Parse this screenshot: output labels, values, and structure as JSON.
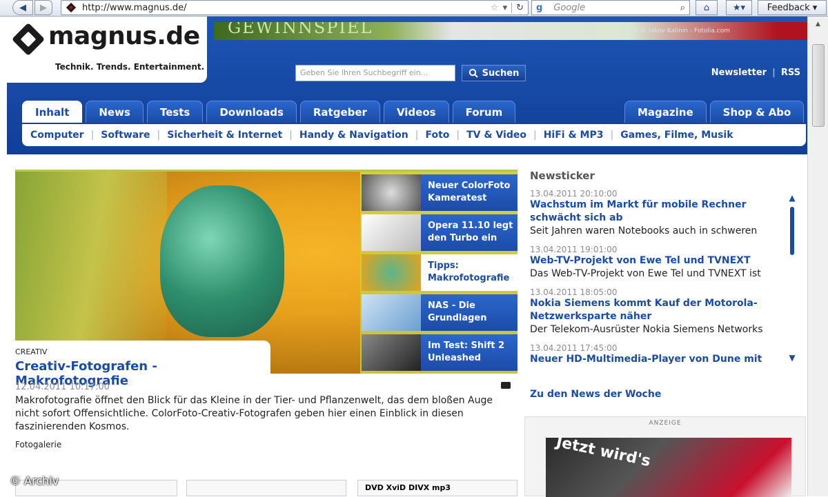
{
  "browser": {
    "url": "http://www.magnus.de/",
    "search_placeholder": "Google",
    "feedback_label": "Feedback"
  },
  "banner": {
    "text": "GEWINNSPIEL",
    "credit": "Foto: © Iakov Kalinin - Fotolia.com"
  },
  "site": {
    "logo_text": "magnus.de",
    "tagline": "Technik. Trends. Entertainment.",
    "search_placeholder": "Geben Sie Ihren Suchbegriff ein...",
    "search_button": "Suchen",
    "top_links": [
      "Newsletter",
      "RSS"
    ]
  },
  "main_nav": {
    "left": [
      "Inhalt",
      "News",
      "Tests",
      "Downloads",
      "Ratgeber",
      "Videos",
      "Forum"
    ],
    "right": [
      "Magazine",
      "Shop & Abo"
    ],
    "active": "Inhalt"
  },
  "sub_nav": [
    "Computer",
    "Software",
    "Sicherheit & Internet",
    "Handy & Navigation",
    "Foto",
    "TV & Video",
    "HiFi & MP3",
    "Games, Filme, Musik"
  ],
  "hero": {
    "kicker": "CREATIV",
    "title": "Creativ-Fotografen - Makrofotografie",
    "date": "12.04.2011 10:17:00",
    "teaser": "Makrofotografie öffnet den Blick für das Kleine in der Tier- und Pflanzenwelt, das dem bloßen Auge nicht sofort Offensichtliche. ColorFoto-Creativ-Fotografen geben hier einen Einblick in diesen faszinierenden Kosmos.",
    "gallery_label": "Fotogalerie",
    "copyright": "© Archiv"
  },
  "teasers": [
    {
      "title": "Neuer ColorFoto Kameratest"
    },
    {
      "title": "Opera 11.10 legt den Turbo ein"
    },
    {
      "title": "Tipps: Makrofotografie"
    },
    {
      "title": "NAS - Die Grundlagen"
    },
    {
      "title": "Im Test: Shift 2 Unleashed"
    }
  ],
  "ticker": {
    "heading": "Newsticker",
    "items": [
      {
        "date": "13.04.2011 20:10:00",
        "title": "Wachstum im Markt für mobile Rechner schwächt sich ab",
        "snippet": "Seit Jahren waren Notebooks auch in schweren"
      },
      {
        "date": "13.04.2011 19:01:00",
        "title": "Web-TV-Projekt von Ewe Tel und TVNEXT",
        "snippet": "Das Web-TV-Projekt von Ewe Tel und TVNEXT ist"
      },
      {
        "date": "13.04.2011 18:05:00",
        "title": "Nokia Siemens kommt Kauf der Motorola-Netzwerksparte näher",
        "snippet": "Der Telekom-Ausrüster Nokia Siemens Networks"
      },
      {
        "date": "13.04.2011 17:45:00",
        "title": "Neuer HD-Multimedia-Player von Dune mit",
        "snippet": ""
      }
    ],
    "week_link": "Zu den News der Woche"
  },
  "ad": {
    "label": "ANZEIGE",
    "headline": "Jetzt wird's"
  },
  "bottom": {
    "formats": "DVD XviD DIVX mp3"
  }
}
